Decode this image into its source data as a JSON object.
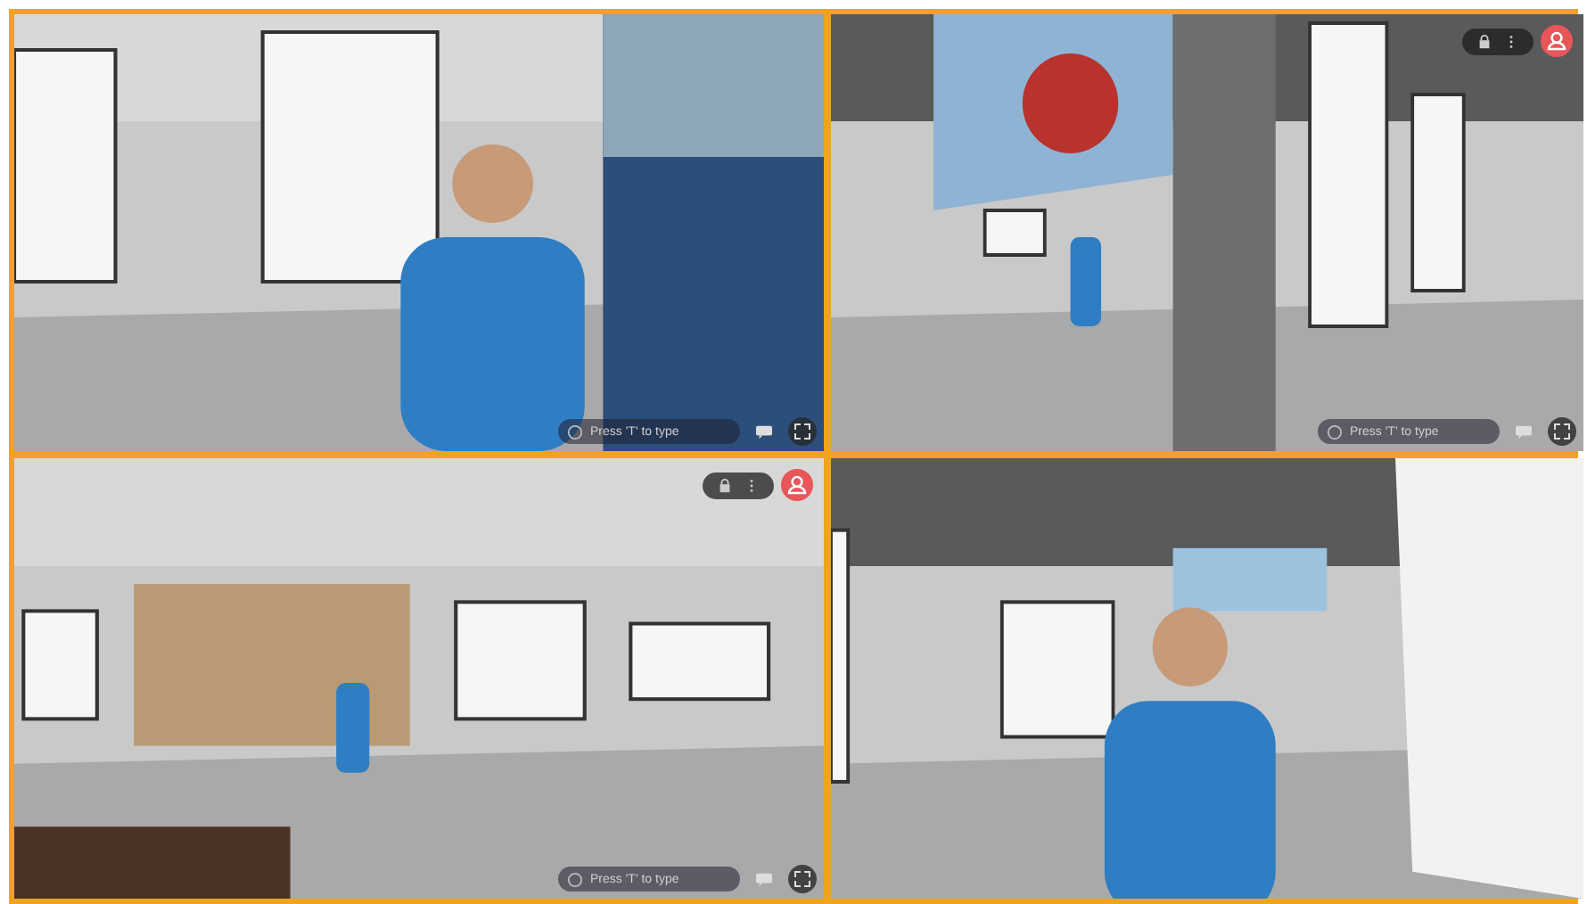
{
  "panels": [
    {
      "kind": "picture",
      "chat_bar": {
        "placeholder": "Press 'T' to type"
      },
      "top_controls": false
    },
    {
      "kind": "picture",
      "chat_bar": {
        "placeholder": "Press 'T' to type"
      },
      "top_controls": true
    },
    {
      "kind": "picture",
      "chat_bar": {
        "placeholder": "Press 'T' to type"
      },
      "top_controls": true
    },
    {
      "kind": "picture",
      "top_controls": false
    }
  ]
}
